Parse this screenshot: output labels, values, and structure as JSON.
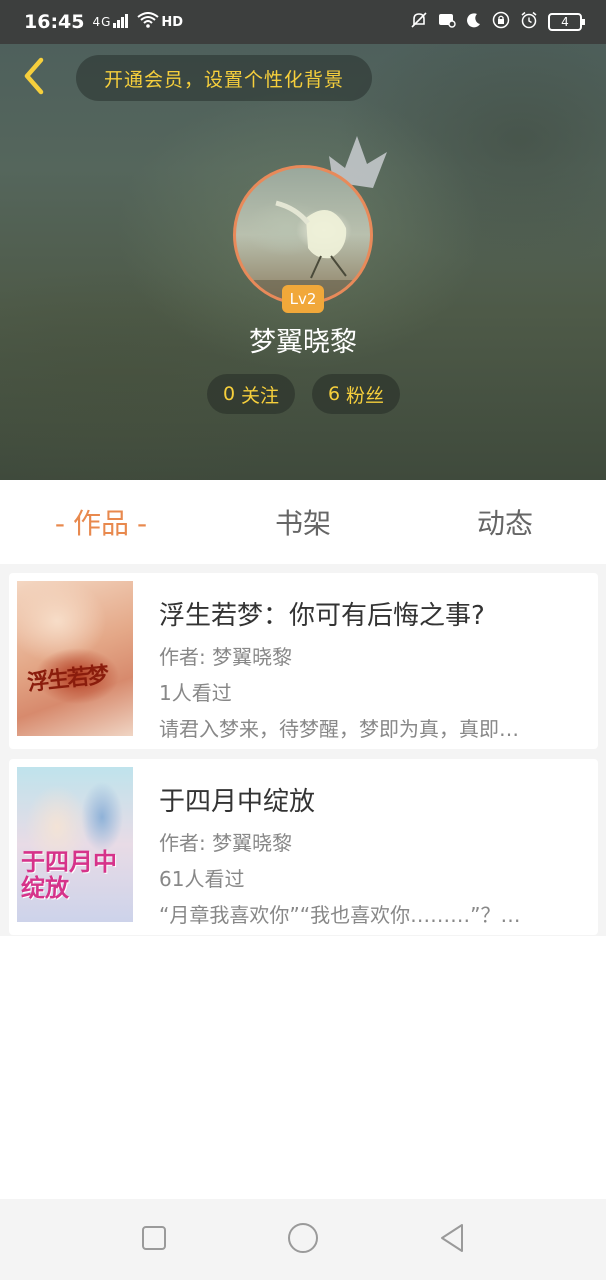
{
  "status_bar": {
    "time": "16:45",
    "signal_text": "4G",
    "hd_text": "HD",
    "battery": "4"
  },
  "header": {
    "vip_prompt": "开通会员，设置个性化背景",
    "level": "Lv2",
    "username": "梦翼晓黎",
    "follow_count": "0",
    "follow_label": "关注",
    "fans_count": "6",
    "fans_label": "粉丝"
  },
  "tabs": [
    {
      "label": "作品",
      "active": true
    },
    {
      "label": "书架",
      "active": false
    },
    {
      "label": "动态",
      "active": false
    }
  ],
  "books": [
    {
      "title": "浮生若梦：你可有后悔之事?",
      "author": "作者: 梦翼晓黎",
      "views": "1人看过",
      "desc": "请君入梦来，待梦醒，梦即为真，真即…",
      "cover_text": "浮生若梦"
    },
    {
      "title": "于四月中绽放",
      "author": "作者: 梦翼晓黎",
      "views": "61人看过",
      "desc": "“月章我喜欢你”“我也喜欢你………”？…",
      "cover_text": "于四月中绽放"
    }
  ],
  "colors": {
    "accent": "#e8894e",
    "vip_text": "#f6cf3c",
    "level_badge": "#f1a83a"
  }
}
